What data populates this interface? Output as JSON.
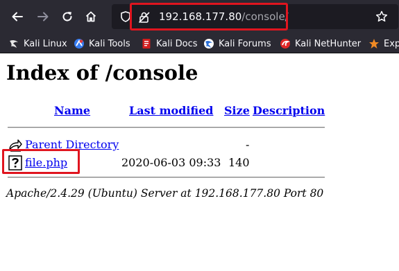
{
  "browser": {
    "url_host": "192.168.177.80",
    "url_path": "/console/",
    "bookmarks": [
      {
        "label": "Kali Linux",
        "icon": "kali-dragon-icon"
      },
      {
        "label": "Kali Tools",
        "icon": "kali-tools-icon"
      },
      {
        "label": "Kali Docs",
        "icon": "kali-docs-icon"
      },
      {
        "label": "Kali Forums",
        "icon": "kali-forums-icon"
      },
      {
        "label": "Kali NetHunter",
        "icon": "kali-nethunter-icon"
      },
      {
        "label": "Exp",
        "icon": "exploit-db-icon"
      }
    ],
    "highlight_color": "#e0151f"
  },
  "page": {
    "title": "Index of /console",
    "columns": {
      "name": "Name",
      "last_modified": "Last modified",
      "size": "Size",
      "description": "Description"
    },
    "rows": [
      {
        "name": "Parent Directory",
        "last_modified": "",
        "size": "-",
        "description": "",
        "icon": "parent-directory-icon"
      },
      {
        "name": "file.php",
        "last_modified": "2020-06-03 09:33",
        "size": "140",
        "description": "",
        "icon": "unknown-file-icon"
      }
    ],
    "address": "Apache/2.4.29 (Ubuntu) Server at 192.168.177.80 Port 80"
  }
}
